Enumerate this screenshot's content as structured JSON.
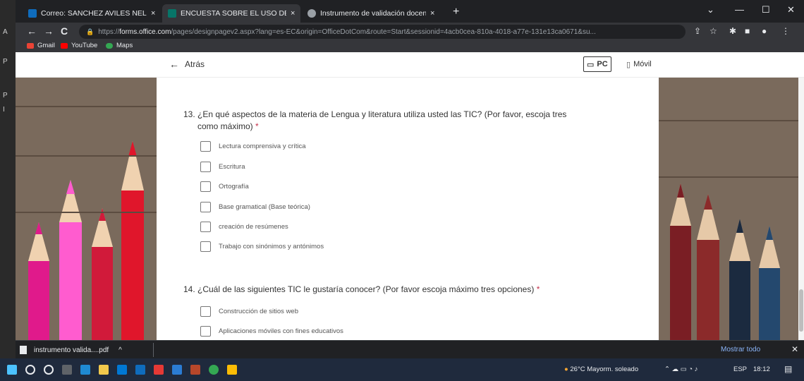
{
  "browser": {
    "tabs": [
      {
        "title": "Correo: SANCHEZ AVILES NELSO",
        "close": "×",
        "icon": "outlook-icon",
        "color": "#0f6cbd",
        "active": false
      },
      {
        "title": "ENCUESTA SOBRE EL USO DE HER",
        "close": "×",
        "icon": "forms-icon",
        "color": "#077568",
        "active": true
      },
      {
        "title": "Instrumento de validación docen",
        "close": "×",
        "icon": "web-icon",
        "color": "#9aa0a6",
        "active": false
      }
    ],
    "new_tab": "+",
    "window_controls": {
      "dropdown": "⌄",
      "minimize": "—",
      "maximize": "☐",
      "close": "✕"
    },
    "nav": {
      "back": "←",
      "forward": "→",
      "reload": "C"
    },
    "url": {
      "prefix": "https://",
      "host": "forms.office.com",
      "rest": "/pages/designpagev2.aspx?lang=es-EC&origin=OfficeDotCom&route=Start&sessionid=4acb0cea-810a-4018-a77e-131e13ca0671&su..."
    },
    "bookmarks": [
      {
        "label": "Gmail",
        "icon": "gmail-icon",
        "color": "#ea4335"
      },
      {
        "label": "YouTube",
        "icon": "youtube-icon",
        "color": "#ff0000"
      },
      {
        "label": "Maps",
        "icon": "maps-icon",
        "color": "#34a853"
      }
    ]
  },
  "form": {
    "back_label": "Atrás",
    "device_pc": "PC",
    "device_mobile": "Móvil",
    "questions": [
      {
        "title_line1": "13. ¿En qué aspectos de la materia de Lengua y literatura utiliza usted las TIC? (Por favor, escoja tres",
        "title_line2": "como máximo)",
        "required_mark": "*",
        "options": [
          "Lectura comprensiva y crítica",
          "Escritura",
          "Ortografía",
          "Base gramatical (Base teórica)",
          "creación de resúmenes",
          "Trabajo con sinónimos y antónimos"
        ]
      },
      {
        "title_line1": "14. ¿Cuál de las siguientes TIC le gustaría conocer? (Por favor escoja máximo tres opciones)",
        "required_mark": "*",
        "options": [
          "Construcción de sitios web",
          "Aplicaciones móviles con fines educativos"
        ]
      }
    ]
  },
  "downloads": {
    "item": "instrumento valida....pdf",
    "chevron": "^",
    "show_all": "Mostrar todo",
    "close": "✕"
  },
  "taskbar": {
    "weather": "26°C  Mayorm. soleado",
    "lang": "ESP",
    "time": "18:12"
  }
}
